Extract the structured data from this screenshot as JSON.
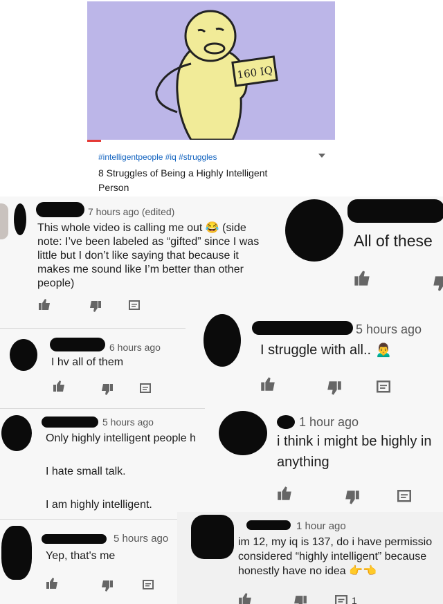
{
  "video": {
    "thumbnail_sign": "160 IQ",
    "hashtags": "#intelligentpeople #iq #struggles",
    "title": "8 Struggles of Being a Highly Intelligent Person"
  },
  "comments": [
    {
      "time": "7 hours ago (edited)",
      "text": "This whole video is calling me out 😂 (side note: I’ve been labeled as “gifted” since I was little but I don’t like saying that because it makes me sound like I’m better than other people)"
    },
    {
      "time": "",
      "text": "All of these"
    },
    {
      "time": "6 hours ago",
      "text": "I hv all of them"
    },
    {
      "time": "5 hours ago",
      "text": "I struggle with all.. 🙍‍♂️"
    },
    {
      "time": "5 hours ago",
      "text": "Only highly intelligent people h",
      "text2": "I hate small talk.",
      "text3": "I am highly intelligent."
    },
    {
      "time": "1 hour ago",
      "text": "i think i might be highly in",
      "text2": "anything"
    },
    {
      "time": "5 hours ago",
      "text": "Yep, that's me"
    },
    {
      "time": "1 hour ago",
      "text": "im 12, my iq is 137, do i have permissio",
      "text2": "considered “highly intelligent” because",
      "text3": "honestly have no idea 👉👈",
      "reply_count": "1"
    }
  ]
}
